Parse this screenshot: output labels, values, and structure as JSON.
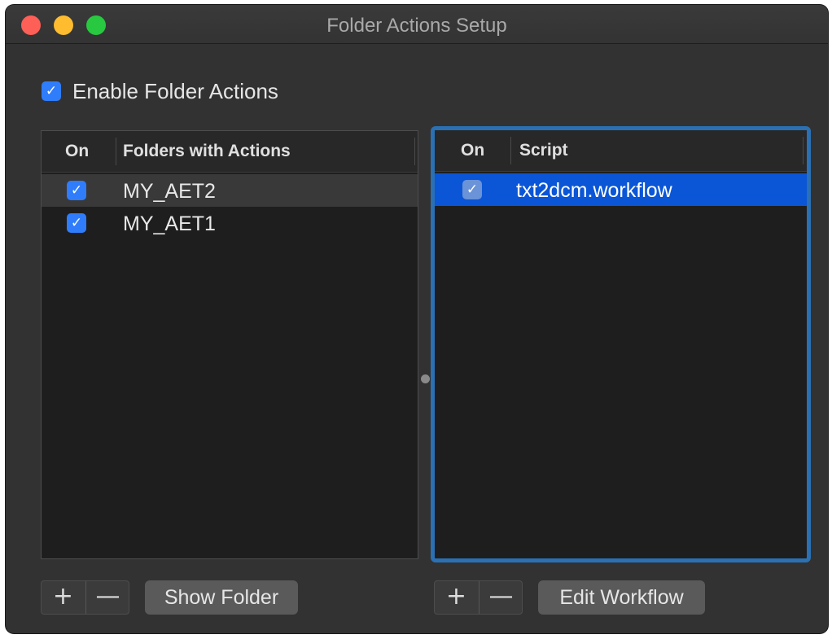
{
  "window": {
    "title": "Folder Actions Setup"
  },
  "enable": {
    "label": "Enable Folder Actions",
    "checked": true,
    "check_glyph": "✓"
  },
  "folders": {
    "col_on": "On",
    "col_name": "Folders with Actions",
    "rows": [
      {
        "name": "MY_AET2",
        "checked": true,
        "check_glyph": "✓"
      },
      {
        "name": "MY_AET1",
        "checked": true,
        "check_glyph": "✓"
      }
    ],
    "add_glyph": "+",
    "remove_glyph": "—",
    "show_folder_label": "Show Folder"
  },
  "scripts": {
    "col_on": "On",
    "col_name": "Script",
    "rows": [
      {
        "name": "txt2dcm.workflow",
        "checked": true,
        "check_glyph": "✓"
      }
    ],
    "add_glyph": "+",
    "remove_glyph": "—",
    "edit_workflow_label": "Edit Workflow"
  },
  "colors": {
    "accent": "#2f7dfb",
    "selection": "#0a56d6",
    "focus_ring": "#2b70b3"
  }
}
